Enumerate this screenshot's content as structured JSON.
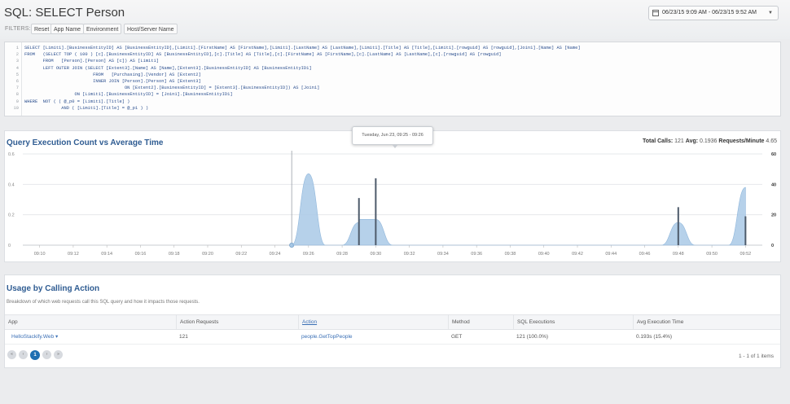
{
  "header": {
    "title": "SQL: SELECT Person",
    "filters_label": "FILTERS:",
    "filters": [
      "Reset",
      "App Name",
      "Environment",
      "Host/Server Name"
    ],
    "date_range": "06/23/15 9:09 AM - 06/23/15 9:52 AM"
  },
  "sql": {
    "lines": [
      {
        "n": "1",
        "indent": "",
        "code": "SELECT [Limit1].[BusinessEntityID] AS [BusinessEntityID],[Limit1].[FirstName] AS [FirstName],[Limit1].[LastName] AS [LastName],[Limit1].[Title] AS [Title],[Limit1].[rowguid] AS [rowguid],[Join1].[Name] AS [Name]"
      },
      {
        "n": "2",
        "indent": "",
        "code": "FROM   (SELECT TOP ( 100 ) [c].[BusinessEntityID] AS [BusinessEntityID],[c].[Title] AS [Title],[c].[FirstName] AS [FirstName],[c].[LastName] AS [LastName],[c].[rowguid] AS [rowguid]"
      },
      {
        "n": "3",
        "indent": "       ",
        "code": "FROM   [Person].[Person] AS [c]) AS [Limit1]"
      },
      {
        "n": "4",
        "indent": "       ",
        "code": "LEFT OUTER JOIN (SELECT [Extent3].[Name] AS [Name],[Extent3].[BusinessEntityID] AS [BusinessEntityID1]"
      },
      {
        "n": "5",
        "indent": "                          ",
        "code": "FROM   [Purchasing].[Vendor] AS [Extent2]"
      },
      {
        "n": "6",
        "indent": "                          ",
        "code": "INNER JOIN [Person].[Person] AS [Extent3]"
      },
      {
        "n": "7",
        "indent": "                                      ",
        "code": "ON [Extent2].[BusinessEntityID] = [Extent3].[BusinessEntityID]) AS [Join1]"
      },
      {
        "n": "8",
        "indent": "                   ",
        "code": "ON [Limit1].[BusinessEntityID] = [Join1].[BusinessEntityID1]"
      },
      {
        "n": "9",
        "indent": "",
        "code": "WHERE  NOT ( ( @_p0 = [Limit1].[Title] )"
      },
      {
        "n": "10",
        "indent": "              ",
        "code": "AND ( [Limit1].[Title] = @_p1 ) )"
      }
    ]
  },
  "chart": {
    "title": "Query Execution Count vs Average Time",
    "stats": {
      "total_calls_label": "Total Calls:",
      "total_calls": "121",
      "avg_label": "Avg:",
      "avg": "0.1936",
      "rpm_label": "Requests/Minute",
      "rpm": "4.65"
    },
    "tooltip": "Tuesday, Jun 23, 09:25 - 09:26"
  },
  "chart_data": {
    "type": "area",
    "title": "Query Execution Count vs Average Time",
    "x": [
      "09:10",
      "09:12",
      "09:14",
      "09:16",
      "09:18",
      "09:20",
      "09:22",
      "09:24",
      "09:26",
      "09:28",
      "09:30",
      "09:32",
      "09:34",
      "09:36",
      "09:38",
      "09:40",
      "09:42",
      "09:44",
      "09:46",
      "09:48",
      "09:50",
      "09:52"
    ],
    "y_left": {
      "ticks": [
        "0",
        "0.2",
        "0.4",
        "0.6"
      ],
      "ylim": [
        0,
        0.6
      ]
    },
    "y_right": {
      "ticks": [
        "0",
        "20",
        "40",
        "60"
      ],
      "ylim": [
        0,
        60
      ]
    },
    "series": [
      {
        "axis": "left",
        "kind": "area",
        "points": [
          [
            9.25,
            0
          ],
          [
            9.26,
            0.47
          ],
          [
            9.27,
            0.0
          ],
          [
            9.28,
            0.0
          ],
          [
            9.285,
            0.15
          ],
          [
            9.29,
            0.17
          ],
          [
            9.3,
            0.17
          ],
          [
            9.31,
            0.0
          ],
          [
            9.47,
            0.0
          ],
          [
            9.48,
            0.15
          ],
          [
            9.49,
            0.0
          ],
          [
            9.51,
            0.0
          ],
          [
            9.52,
            0.38
          ]
        ]
      },
      {
        "axis": "right",
        "kind": "bar",
        "points": [
          [
            9.29,
            31
          ],
          [
            9.3,
            44
          ],
          [
            9.485,
            25
          ],
          [
            9.52,
            19
          ]
        ]
      }
    ],
    "grid": true,
    "crosshair_x": "09:25"
  },
  "usage": {
    "title": "Usage by Calling Action",
    "description": "Breakdown of which web requests call this SQL query and how it impacts those requests.",
    "columns": [
      "App",
      "Action Requests",
      "Action",
      "Method",
      "SQL Executions",
      "Avg Execution Time"
    ],
    "rows": [
      [
        "HelloStackify.Web",
        "121",
        "people.GetTopPeople",
        "GET",
        "121 (100.0%)",
        "0.193s (15.4%)"
      ]
    ],
    "pager": {
      "first": "«",
      "prev": "‹",
      "page": "1",
      "next": "›",
      "last": "»"
    },
    "pager_info": "1 - 1 of 1 items"
  },
  "colors": {
    "accent": "#2f5c92",
    "area": "#a9c9e6",
    "bar": "#4e5b6b",
    "active_page": "#1f6fb2"
  }
}
